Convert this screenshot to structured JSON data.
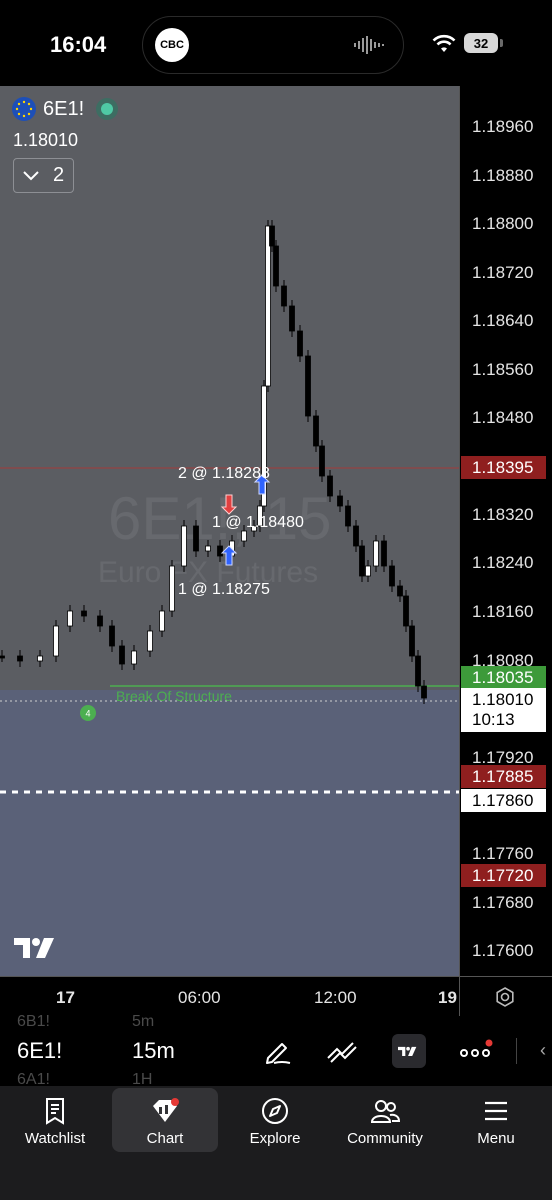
{
  "status_bar": {
    "time": "16:04",
    "battery": "32",
    "island_app": "CBC"
  },
  "chart": {
    "symbol": "6E1!",
    "last_price": "1.18010",
    "collapse_count": "2",
    "watermark_symbol": "6E1!, 15",
    "watermark_name": "Euro FX Futures",
    "trades": [
      {
        "label": "2 @ 1.18288",
        "side": "buy"
      },
      {
        "label": "1 @ 1.18480",
        "side": "sell"
      },
      {
        "label": "1 @ 1.18275",
        "side": "buy"
      }
    ],
    "bos_label": "Break Of Structure",
    "bos_marker": "4",
    "colors": {
      "background": "#5b5d62",
      "zone": "#5a6178",
      "bos_line": "#4caf50",
      "resistance_line": "#a33a3a",
      "buy_arrow": "#2f63ff",
      "sell_arrow": "#e14040"
    }
  },
  "price_axis": {
    "ticks": [
      "1.18960",
      "1.18880",
      "1.18800",
      "1.18720",
      "1.18640",
      "1.18560",
      "1.18480",
      "1.18320",
      "1.18240",
      "1.18160",
      "1.18080",
      "1.17920",
      "1.17760",
      "1.17680",
      "1.17600"
    ],
    "tags": {
      "resistance": "1.18395",
      "bos": "1.18035",
      "current": "1.18010",
      "countdown": "10:13",
      "level_red": "1.17885",
      "level_white": "1.17860",
      "level_low": "1.17720"
    }
  },
  "time_axis": {
    "labels": [
      "17",
      "06:00",
      "12:00",
      "19"
    ]
  },
  "toolbar": {
    "symbol": "6E1!",
    "interval": "15m",
    "ghost_above": [
      "6B1!",
      "5m"
    ],
    "ghost_below": [
      "6A1!",
      "1H"
    ]
  },
  "nav": {
    "items": [
      {
        "label": "Watchlist",
        "icon": "watchlist-icon"
      },
      {
        "label": "Chart",
        "icon": "chart-icon"
      },
      {
        "label": "Explore",
        "icon": "compass-icon"
      },
      {
        "label": "Community",
        "icon": "community-icon"
      },
      {
        "label": "Menu",
        "icon": "menu-icon"
      }
    ],
    "active": "Chart"
  }
}
